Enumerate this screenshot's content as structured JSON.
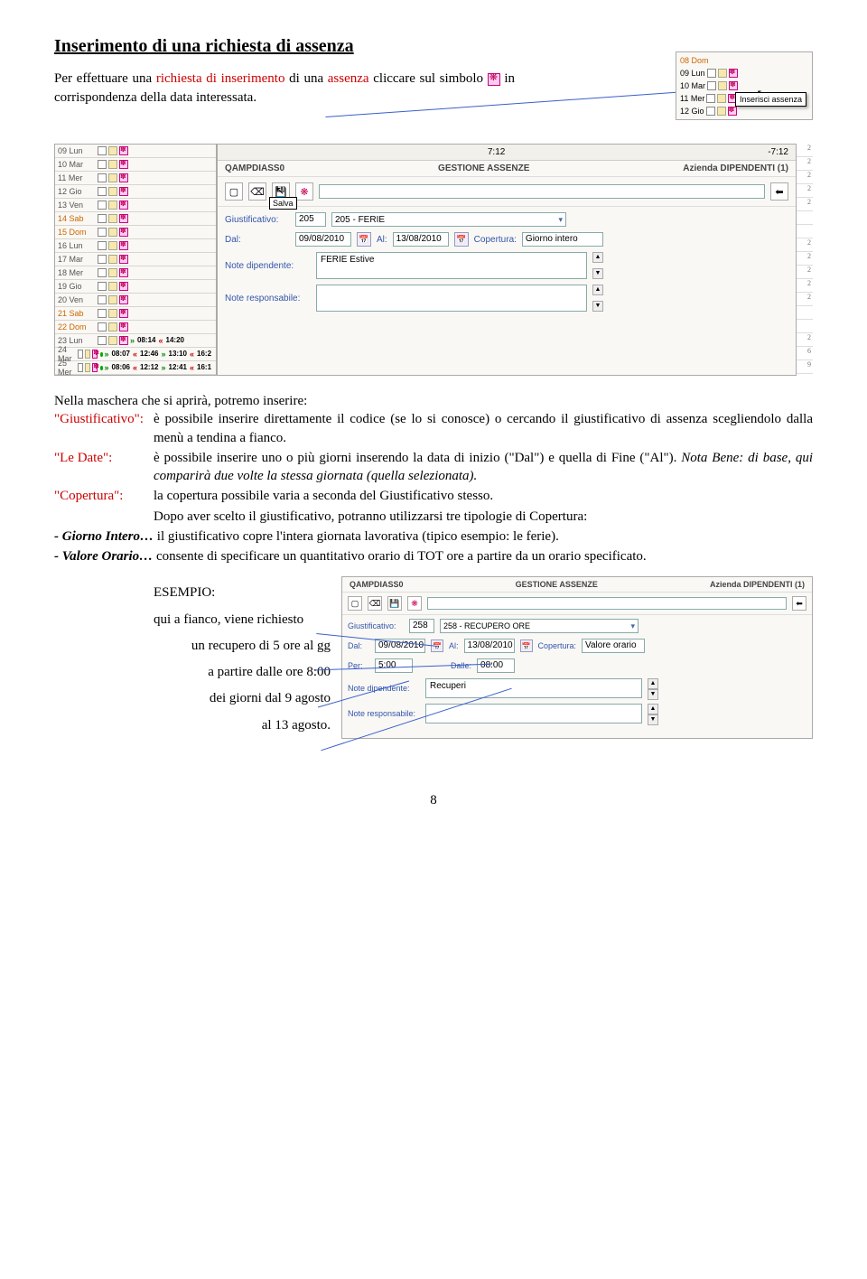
{
  "title": "Inserimento di una richiesta di assenza",
  "intro_part1": "Per effettuare una ",
  "intro_red1": "richiesta di inserimento",
  "intro_part2": " di una ",
  "intro_red2": "assenza",
  "intro_part3": " cliccare sul simbolo ",
  "intro_part4": " in corrispondenza della data interessata.",
  "mini": {
    "rows": [
      {
        "d": "08 Dom"
      },
      {
        "d": "09 Lun"
      },
      {
        "d": "10 Mar"
      },
      {
        "d": "11 Mer"
      },
      {
        "d": "12 Gio"
      }
    ],
    "popup": "Inserisci assenza"
  },
  "daycol": [
    {
      "d": "09 Lun"
    },
    {
      "d": "10 Mar"
    },
    {
      "d": "11 Mer"
    },
    {
      "d": "12 Gio"
    },
    {
      "d": "13 Ven"
    },
    {
      "d": "14 Sab",
      "o": true
    },
    {
      "d": "15 Dom",
      "o": true
    },
    {
      "d": "16 Lun"
    },
    {
      "d": "17 Mar"
    },
    {
      "d": "18 Mer"
    },
    {
      "d": "19 Gio"
    },
    {
      "d": "20 Ven"
    },
    {
      "d": "21 Sab",
      "o": true
    },
    {
      "d": "22 Dom",
      "o": true
    },
    {
      "d": "23 Lun",
      "t": [
        [
          "g",
          "08:14"
        ],
        [
          "r",
          "14:20"
        ]
      ]
    },
    {
      "d": "24 Mar",
      "dot": true,
      "t": [
        [
          "g",
          "08:07"
        ],
        [
          "r",
          "12:46"
        ],
        [
          "g",
          "13:10"
        ],
        [
          "r",
          "16:2"
        ]
      ]
    },
    {
      "d": "25 Mer",
      "dot": true,
      "t": [
        [
          "g",
          "08:06"
        ],
        [
          "r",
          "12:12"
        ],
        [
          "g",
          "12:41"
        ],
        [
          "r",
          "16:1"
        ]
      ]
    }
  ],
  "right_nums": [
    "2",
    "2",
    "2",
    "2",
    "2",
    "",
    "",
    "2",
    "2",
    "2",
    "2",
    "2",
    "",
    "",
    "2",
    "6",
    "9"
  ],
  "topbar": {
    "time1": "7:12",
    "time2": "-7:12"
  },
  "gp": {
    "code": "QAMPDIASS0",
    "title": "GESTIONE ASSENZE",
    "azienda": "Azienda DIPENDENTI (1)",
    "salva": "Salva",
    "giust_label": "Giustificativo:",
    "giust_code": "205",
    "giust_text": "205 - FERIE",
    "dal_label": "Dal:",
    "dal_val": "09/08/2010",
    "al_label": "Al:",
    "al_val": "13/08/2010",
    "cop_label": "Copertura:",
    "cop_val": "Giorno intero",
    "note_dip_label": "Note dipendente:",
    "note_dip_val": "FERIE Estive",
    "note_resp_label": "Note responsabile:",
    "note_resp_val": ""
  },
  "body": {
    "intro": "Nella maschera che si aprirà, potremo inserire:",
    "giust_label": "\"Giustificativo\":",
    "giust_text": "è possibile inserire direttamente il codice (se lo si conosce) o cercando il giustificativo di assenza scegliendolo dalla menù a tendina a fianco.",
    "date_label": "\"Le Date\":",
    "date_text1": "è possibile inserire uno o più giorni inserendo la data di inizio (\"Dal\") e quella di Fine (\"Al\"). ",
    "date_nb": "Nota Bene: di base, qui comparirà due volte la stessa giornata (quella selezionata).",
    "cop_label": "\"Copertura\":",
    "cop_text": "la copertura possibile varia a seconda del Giustificativo stesso.",
    "cop_after": "Dopo aver scelto il giustificativo, potranno utilizzarsi tre tipologie di Copertura:",
    "gi_label": "- Giorno Intero…",
    "gi_text": " il giustificativo copre l'intera giornata lavorativa (tipico esempio: le ferie).",
    "vo_label": "- Valore Orario…",
    "vo_text": " consente di specificare un quantitativo orario di TOT ore a partire da un orario specificato."
  },
  "example": {
    "l1": "ESEMPIO:",
    "l2": "qui a fianco, viene richiesto",
    "l3": "un recupero di 5 ore al gg",
    "l4": "a partire dalle ore 8:00",
    "l5": "dei giorni dal 9 agosto",
    "l6": "al 13 agosto."
  },
  "gp2": {
    "code": "QAMPDIASS0",
    "title": "GESTIONE ASSENZE",
    "azienda": "Azienda DIPENDENTI (1)",
    "giust_label": "Giustificativo:",
    "giust_code": "258",
    "giust_text": "258 - RECUPERO ORE",
    "dal_label": "Dal:",
    "dal_val": "09/08/2010",
    "al_label": "Al:",
    "al_val": "13/08/2010",
    "cop_label": "Copertura:",
    "cop_val": "Valore orario",
    "per_label": "Per:",
    "per_val": "5:00",
    "dalle_label": "Dalle:",
    "dalle_val": "08:00",
    "note_dip_label": "Note dipendente:",
    "note_dip_val": "Recuperi",
    "note_resp_label": "Note responsabile:",
    "note_resp_val": ""
  },
  "pagenum": "8"
}
